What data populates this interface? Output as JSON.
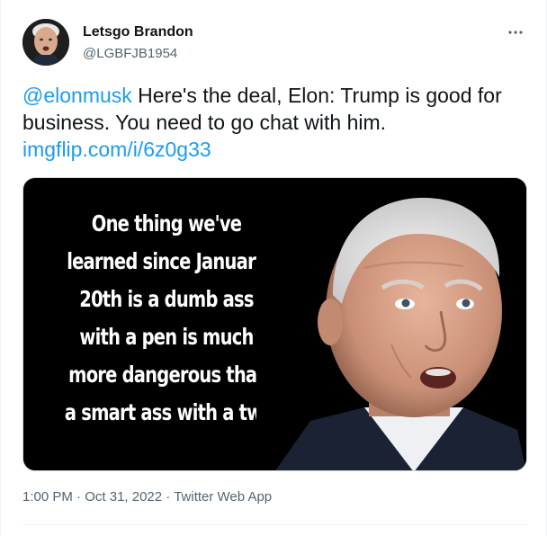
{
  "user": {
    "display_name": "Letsgo Brandon",
    "handle": "@LGBFJB1954"
  },
  "tweet": {
    "mention": "@elonmusk",
    "body": " Here's the deal, Elon: Trump is good for business. You need to go chat with him. ",
    "link": "imgflip.com/i/6z0g33"
  },
  "media": {
    "caption_lines": [
      "One thing we've",
      "learned since January",
      "20th is a dumb ass",
      "with a pen is much",
      "more dangerous that",
      "a smart ass with a tweet."
    ]
  },
  "meta": {
    "time": "1:00 PM",
    "separator": " · ",
    "date": "Oct 31, 2022",
    "source": "Twitter Web App"
  },
  "icons": {
    "more": "more-horizontal-icon"
  },
  "colors": {
    "link": "#1d9bf0",
    "secondary_text": "#536471",
    "primary_text": "#0f1419"
  }
}
